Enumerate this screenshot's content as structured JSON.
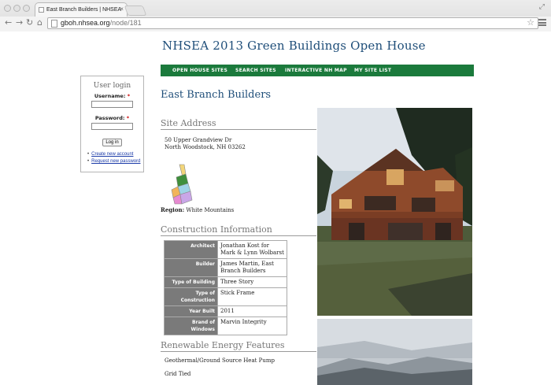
{
  "browser": {
    "tab_title": "East Branch Builders | NHSEA",
    "url_host": "gboh.nhsea.org",
    "url_path": "/node/181"
  },
  "site": {
    "title": "NHSEA 2013 Green Buildings Open House",
    "nav": [
      "OPEN HOUSE SITES",
      "SEARCH SITES",
      "INTERACTIVE NH MAP",
      "MY SITE LIST"
    ]
  },
  "login": {
    "title": "User login",
    "username_label": "Username:",
    "password_label": "Password:",
    "required_mark": "*",
    "login_button": "Log in",
    "links": [
      "Create new account",
      "Request new password"
    ]
  },
  "page": {
    "title": "East Branch Builders",
    "address_heading": "Site Address",
    "address_line1": "50 Upper Grandview Dr",
    "address_line2": "North Woodstock, NH 03262",
    "region_label": "Region:",
    "region_value": "White Mountains",
    "construction_heading": "Construction Information",
    "construction": [
      {
        "k": "Architect",
        "v": "Jonathan Kost for Mark & Lynn Wolbarst"
      },
      {
        "k": "Builder",
        "v": "James Martin, East Branch Builders"
      },
      {
        "k": "Type of Building",
        "v": "Three Story"
      },
      {
        "k": "Type of Construction",
        "v": "Stick Frame"
      },
      {
        "k": "Year Built",
        "v": "2011"
      },
      {
        "k": "Brand of Windows",
        "v": "Marvin Integrity"
      }
    ],
    "renewable_heading": "Renewable Energy Features",
    "renewable": [
      "Geothermal/Ground Source Heat Pump",
      "Grid Tied"
    ]
  },
  "colors": {
    "nav_green": "#1b7a3c",
    "title_blue": "#1f4e79",
    "table_label_bg": "#7a7a7a"
  }
}
